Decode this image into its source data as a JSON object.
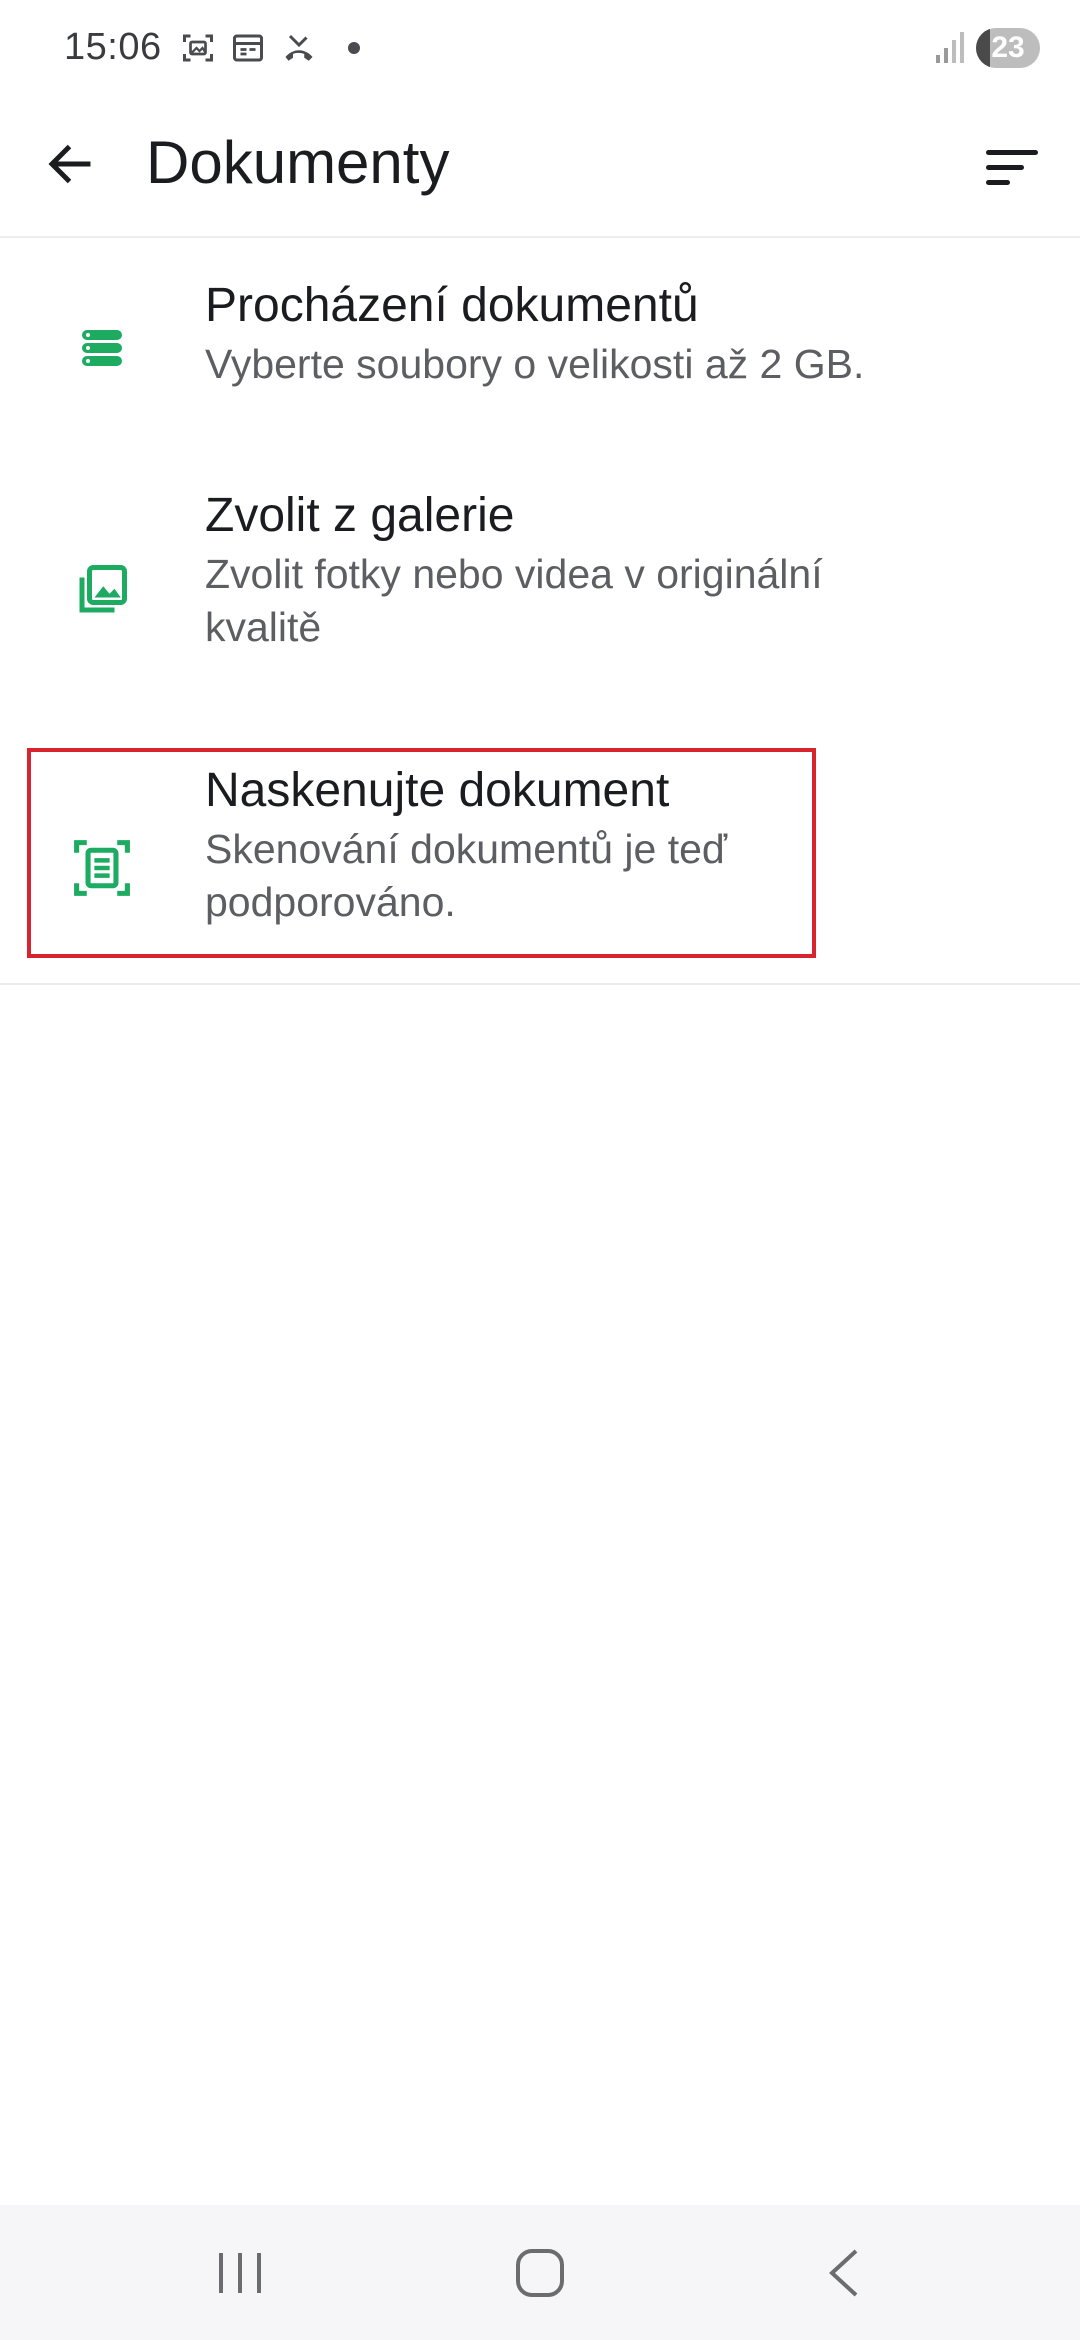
{
  "status_bar": {
    "time": "15:06",
    "battery": "23",
    "icons": [
      "screenshot-icon",
      "calendar-icon",
      "missed-call-icon",
      "notification-dot",
      "signal-icon",
      "battery-icon"
    ]
  },
  "app_bar": {
    "title": "Dokumenty",
    "back_icon": "arrow-back-icon",
    "sort_icon": "sort-icon"
  },
  "menu": {
    "items": [
      {
        "icon": "storage-icon",
        "title": "Procházení dokumentů",
        "subtitle_lines": [
          "Vyberte soubory o velikosti až 2 GB."
        ]
      },
      {
        "icon": "gallery-icon",
        "title": "Zvolit z galerie",
        "subtitle_lines": [
          "Zvolit fotky nebo videa v originální",
          "kvalitě"
        ]
      },
      {
        "icon": "scan-document-icon",
        "title": "Naskenujte dokument",
        "subtitle_lines": [
          "Skenování dokumentů je teď",
          "podporováno."
        ]
      }
    ]
  },
  "colors": {
    "accent": "#1daa61",
    "highlight": "#d9232e",
    "text_primary": "#1b1c1f",
    "text_secondary": "#5c5e62",
    "nav_bg": "#f6f6f8"
  },
  "nav_bar": {
    "buttons": [
      "recent-apps-icon",
      "home-icon",
      "back-icon"
    ]
  }
}
